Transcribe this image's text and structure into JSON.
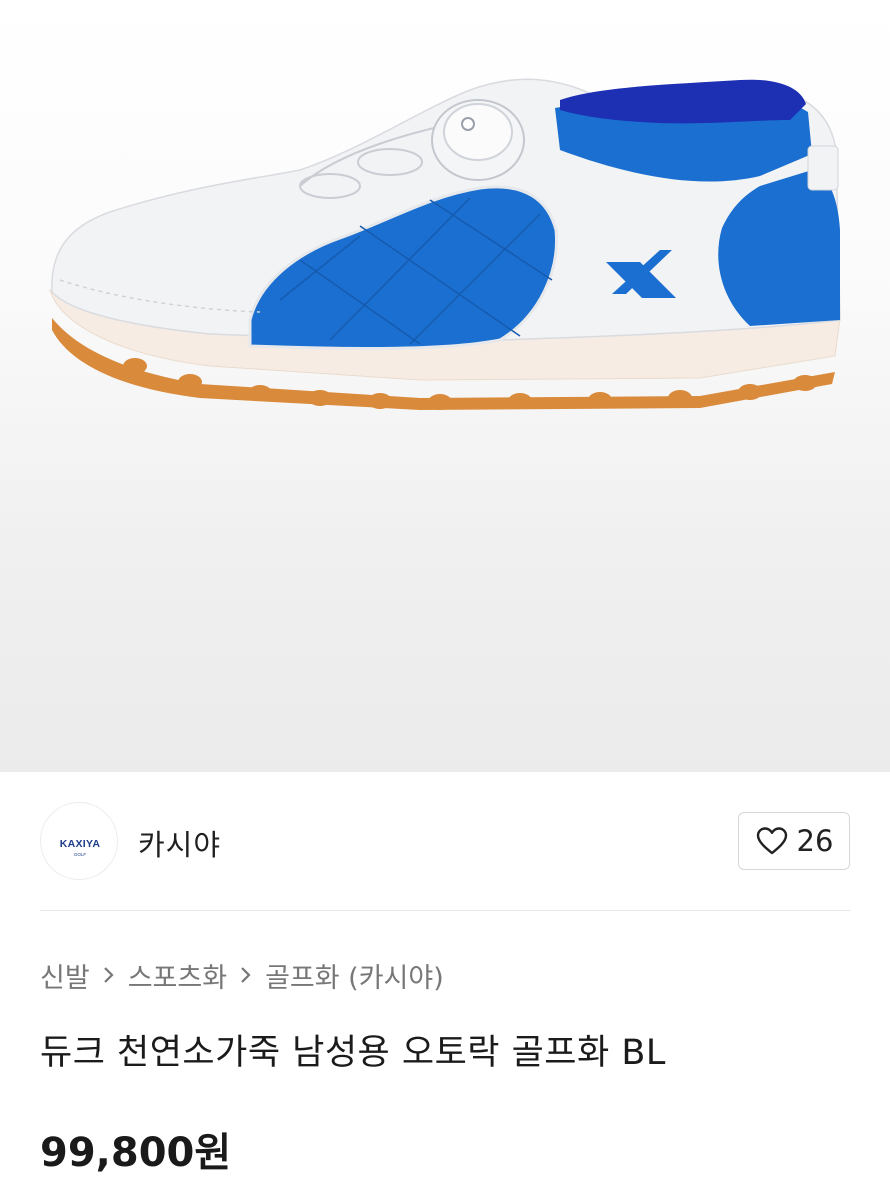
{
  "product_image": {
    "alt": "",
    "colors": {
      "blue": "#1a6fd0",
      "dark_blue": "#1d2fb3",
      "white": "#f2f3f5",
      "sole_cream": "#f6ece4",
      "outsole_tan": "#d98a3a"
    }
  },
  "seller": {
    "logo_text": "KAXIYA",
    "logo_subtext": "GOLF",
    "name": "카시야"
  },
  "like": {
    "icon": "heart-icon",
    "count": "26"
  },
  "breadcrumb": [
    {
      "label": "신발"
    },
    {
      "label": "스포츠화"
    },
    {
      "label": "골프화 (카시야)"
    }
  ],
  "product": {
    "title": "듀크 천연소가죽 남성용 오토락 골프화 BL",
    "price": "99,800원"
  }
}
